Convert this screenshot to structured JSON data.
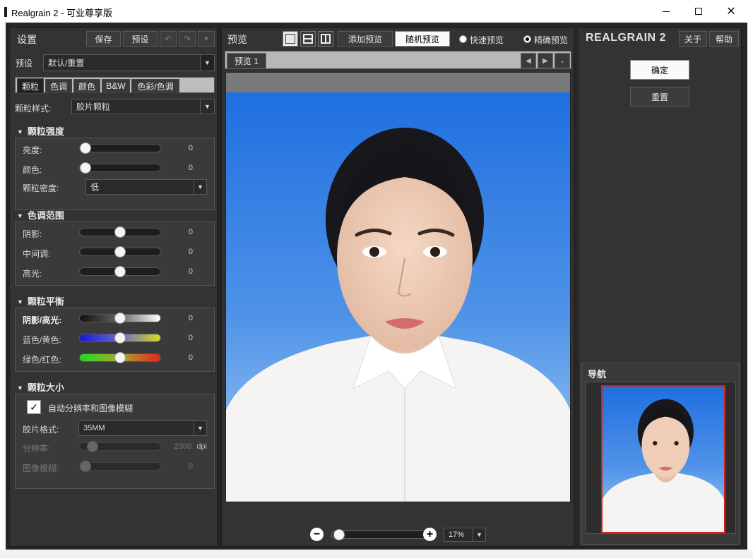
{
  "window": {
    "title": "Realgrain 2 - 可业尊享版"
  },
  "settings": {
    "title": "设置",
    "save_label": "保存",
    "preset_button_label": "预设",
    "preset_label": "预设",
    "preset_value": "默认/重置",
    "tabs": [
      {
        "label": "颗粒"
      },
      {
        "label": "色调"
      },
      {
        "label": "颜色"
      },
      {
        "label": "B&W"
      },
      {
        "label": "色彩/色调"
      }
    ],
    "grain_style_label": "颗粒样式:",
    "grain_style_value": "胶片颗粒",
    "sections": {
      "grain_strength": {
        "title": "颗粒强度",
        "brightness_label": "亮度:",
        "brightness_value": "0",
        "brightness_level": 0,
        "color_label": "颜色:",
        "color_value": "0",
        "color_level": 0,
        "density_label": "颗粒密度:",
        "density_value": "低"
      },
      "tonal_range": {
        "title": "色调范围",
        "shadows_label": "阴影:",
        "shadows_value": "0",
        "shadows_level": 0.5,
        "midtones_label": "中间调:",
        "midtones_value": "0",
        "midtones_level": 0.5,
        "highlights_label": "高光:",
        "highlights_value": "0",
        "highlights_level": 0.5
      },
      "grain_balance": {
        "title": "颗粒平衡",
        "shadow_highlight_label": "阴影/高光:",
        "shadow_highlight_value": "0",
        "shadow_highlight_level": 0.5,
        "blue_yellow_label": "蓝色/黄色:",
        "blue_yellow_value": "0",
        "blue_yellow_level": 0.5,
        "green_red_label": "绿色/红色:",
        "green_red_value": "0",
        "green_red_level": 0.5
      },
      "grain_size": {
        "title": "颗粒大小",
        "auto_label": "自动分辨率和图像模糊",
        "auto_checked": true,
        "film_format_label": "胶片格式:",
        "film_format_value": "35MM",
        "resolution_label": "分辨率:",
        "resolution_value": "2300",
        "resolution_unit": "dpi",
        "resolution_level": 0.1,
        "blur_label": "图像模糊:",
        "blur_value": "0",
        "blur_level": 0
      }
    }
  },
  "preview": {
    "title": "预览",
    "add_preview_label": "添加预览",
    "random_preview_label": "随机预览",
    "fast_preview_label": "快速预览",
    "accurate_preview_label": "精确预览",
    "selected_mode": "accurate",
    "tab_label": "预览 1",
    "zoom_value": "17%"
  },
  "right": {
    "logo": "REALGRAIN 2",
    "about_label": "关于",
    "help_label": "帮助",
    "ok_label": "确定",
    "reset_label": "重置",
    "navigator_title": "导航"
  },
  "colors": {
    "sky_top": "#1f6fe0",
    "sky_bottom": "#a6cdf2",
    "nav_border": "#d42020"
  },
  "icons": {
    "undo": "undo-icon",
    "redo": "redo-icon",
    "chevron": "chevron-down-icon",
    "zoom_out": "minus-circle-icon",
    "zoom_in": "plus-circle-icon"
  }
}
